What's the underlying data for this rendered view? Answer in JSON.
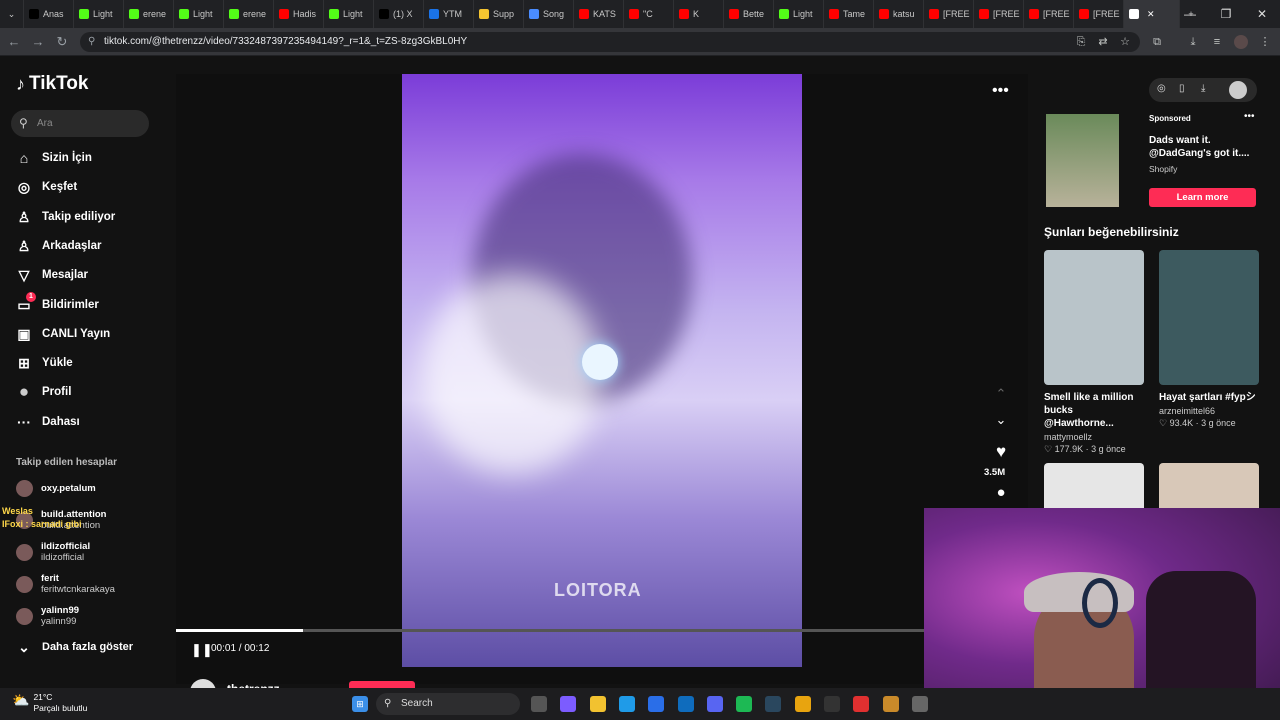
{
  "browser": {
    "tabs": [
      {
        "label": "Anas",
        "icon": "x-icon",
        "color": "#000000"
      },
      {
        "label": "Light",
        "icon": "kick-icon",
        "color": "#53fc18"
      },
      {
        "label": "erene",
        "icon": "kick-icon",
        "color": "#53fc18"
      },
      {
        "label": "Light",
        "icon": "kick-icon",
        "color": "#53fc18"
      },
      {
        "label": "erene",
        "icon": "kick-icon",
        "color": "#53fc18"
      },
      {
        "label": "Hadis",
        "icon": "youtube-icon",
        "color": "#ff0000"
      },
      {
        "label": "Light",
        "icon": "kick-icon",
        "color": "#53fc18"
      },
      {
        "label": "(1) X",
        "icon": "x-icon",
        "color": "#000000"
      },
      {
        "label": "YTM",
        "icon": "ytm-icon",
        "color": "#1a73e8"
      },
      {
        "label": "Supp",
        "icon": "r-icon",
        "color": "#f4c430"
      },
      {
        "label": "Song",
        "icon": "note-icon",
        "color": "#4a8cff"
      },
      {
        "label": "KATS",
        "icon": "youtube-icon",
        "color": "#ff0000"
      },
      {
        "label": "\"C",
        "icon": "youtube-icon",
        "color": "#ff0000"
      },
      {
        "label": "K",
        "icon": "youtube-icon",
        "color": "#ff0000"
      },
      {
        "label": "Bette",
        "icon": "youtube-icon",
        "color": "#ff0000"
      },
      {
        "label": "Light",
        "icon": "kick-icon",
        "color": "#53fc18"
      },
      {
        "label": "Tame",
        "icon": "youtube-icon",
        "color": "#ff0000"
      },
      {
        "label": "katsu",
        "icon": "youtube-icon",
        "color": "#ff0000"
      },
      {
        "label": "[FREE",
        "icon": "youtube-icon",
        "color": "#ff0000"
      },
      {
        "label": "[FREE",
        "icon": "youtube-icon",
        "color": "#ff0000"
      },
      {
        "label": "[FREE",
        "icon": "youtube-icon",
        "color": "#ff0000"
      },
      {
        "label": "[FREE",
        "icon": "youtube-icon",
        "color": "#ff0000"
      },
      {
        "label": "",
        "icon": "tiktok-icon",
        "color": "#ffffff",
        "active": true
      }
    ],
    "url": "tiktok.com/@thetrenzz/video/7332487397235494149?_r=1&_t=ZS-8zg3GkBL0HY"
  },
  "sidebar": {
    "logo": "TikTok",
    "search_placeholder": "Ara",
    "items": [
      {
        "label": "Sizin İçin",
        "icon": "home-icon"
      },
      {
        "label": "Keşfet",
        "icon": "compass-icon"
      },
      {
        "label": "Takip ediliyor",
        "icon": "person-icon"
      },
      {
        "label": "Arkadaşlar",
        "icon": "friends-icon"
      },
      {
        "label": "Mesajlar",
        "icon": "send-icon"
      },
      {
        "label": "Bildirimler",
        "icon": "inbox-icon",
        "badge": "1"
      },
      {
        "label": "CANLI Yayın",
        "icon": "live-icon"
      },
      {
        "label": "Yükle",
        "icon": "plus-icon"
      },
      {
        "label": "Profil",
        "icon": "avatar-icon"
      },
      {
        "label": "Dahası",
        "icon": "more-icon"
      }
    ],
    "following_header": "Takip edilen hesaplar",
    "accounts": [
      {
        "name": "oxy.petalum",
        "user": ""
      },
      {
        "name": "build.attention",
        "user": "build.attention"
      },
      {
        "name": "ildizofficial",
        "user": "ildizofficial"
      },
      {
        "name": "ferit",
        "user": "feritwtcnkarakaya"
      },
      {
        "name": "yalinn99",
        "user": "yalinn99"
      }
    ],
    "show_more": "Daha fazla göster"
  },
  "chat_overlay": {
    "line1": "Weslas",
    "line2": "IFoxi : sarnadi gibi"
  },
  "player": {
    "watermark": "LOITORA",
    "progress": 0.17,
    "time": "00:01 / 00:12",
    "likes": "3.5M",
    "author": "thetrenzz"
  },
  "ad": {
    "sponsored": "Sponsored",
    "title": "Dads want it. @DadGang's got it....",
    "brand": "Shopify",
    "cta": "Learn more"
  },
  "recommendations": {
    "header": "Şunları beğenebilirsiniz",
    "items": [
      {
        "title": "Smell like a million bucks @Hawthorne...",
        "user": "mattymoellz",
        "likes": "177.9K",
        "age": "3 g önce",
        "thumb": "#b9c4c9"
      },
      {
        "title": "Hayat şartları #fypシ",
        "user": "arzneimittel66",
        "likes": "93.4K",
        "age": "3 g önce",
        "thumb": "#3d5a5f"
      },
      {
        "title": "",
        "user": "",
        "likes": "",
        "age": "",
        "thumb": "#e6e6e6"
      },
      {
        "title": "",
        "user": "",
        "likes": "",
        "age": "",
        "thumb": "#d8c8b8"
      }
    ]
  },
  "taskbar": {
    "temp": "21°C",
    "weather": "Parçalı bulutlu",
    "search": "Search"
  }
}
